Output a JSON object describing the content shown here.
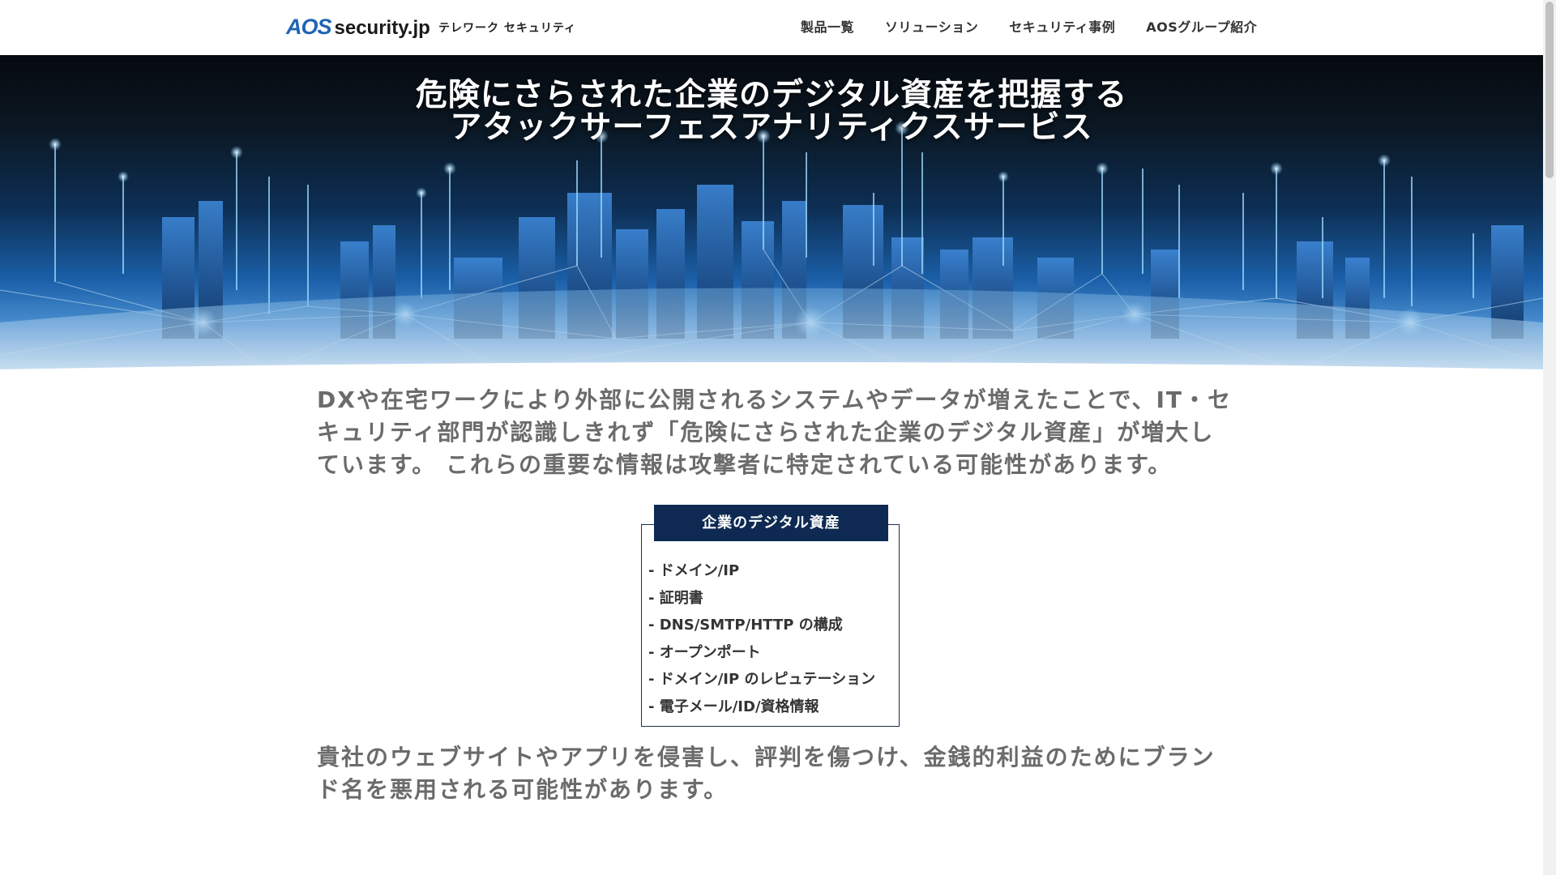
{
  "header": {
    "logo_mark": "AOS",
    "logo_domain": "security.jp",
    "tagline": "テレワーク セキュリティ",
    "nav": [
      {
        "label": "製品一覧"
      },
      {
        "label": "ソリューション"
      },
      {
        "label": "セキュリティ事例"
      },
      {
        "label": "AOSグループ紹介"
      }
    ]
  },
  "hero": {
    "title_line1": "危険にさらされた企業のデジタル資産を把握する",
    "title_line2": "アタックサーフェスアナリティクスサービス"
  },
  "main": {
    "intro": "DXや在宅ワークにより外部に公開されるシステムやデータが増えたことで、IT・セキュリティ部門が認識しきれず「危険にさらされた企業のデジタル資産」が増大しています。 これらの重要な情報は攻撃者に特定されている可能性があります。",
    "asset_box": {
      "title": "企業のデジタル資産",
      "items": [
        "- ドメイン/IP",
        "- 証明書",
        "- DNS/SMTP/HTTP の構成",
        "- オープンポート",
        "- ドメイン/IP のレピュテーション",
        "- 電子メール/ID/資格情報"
      ]
    },
    "outro": "貴社のウェブサイトやアプリを侵害し、評判を傷つけ、金銭的利益のためにブランド名を悪用される可能性があります。"
  },
  "colors": {
    "brand_blue": "#1f64b4",
    "box_navy": "#0e2a52",
    "body_text_gray": "#6b6b6b"
  }
}
